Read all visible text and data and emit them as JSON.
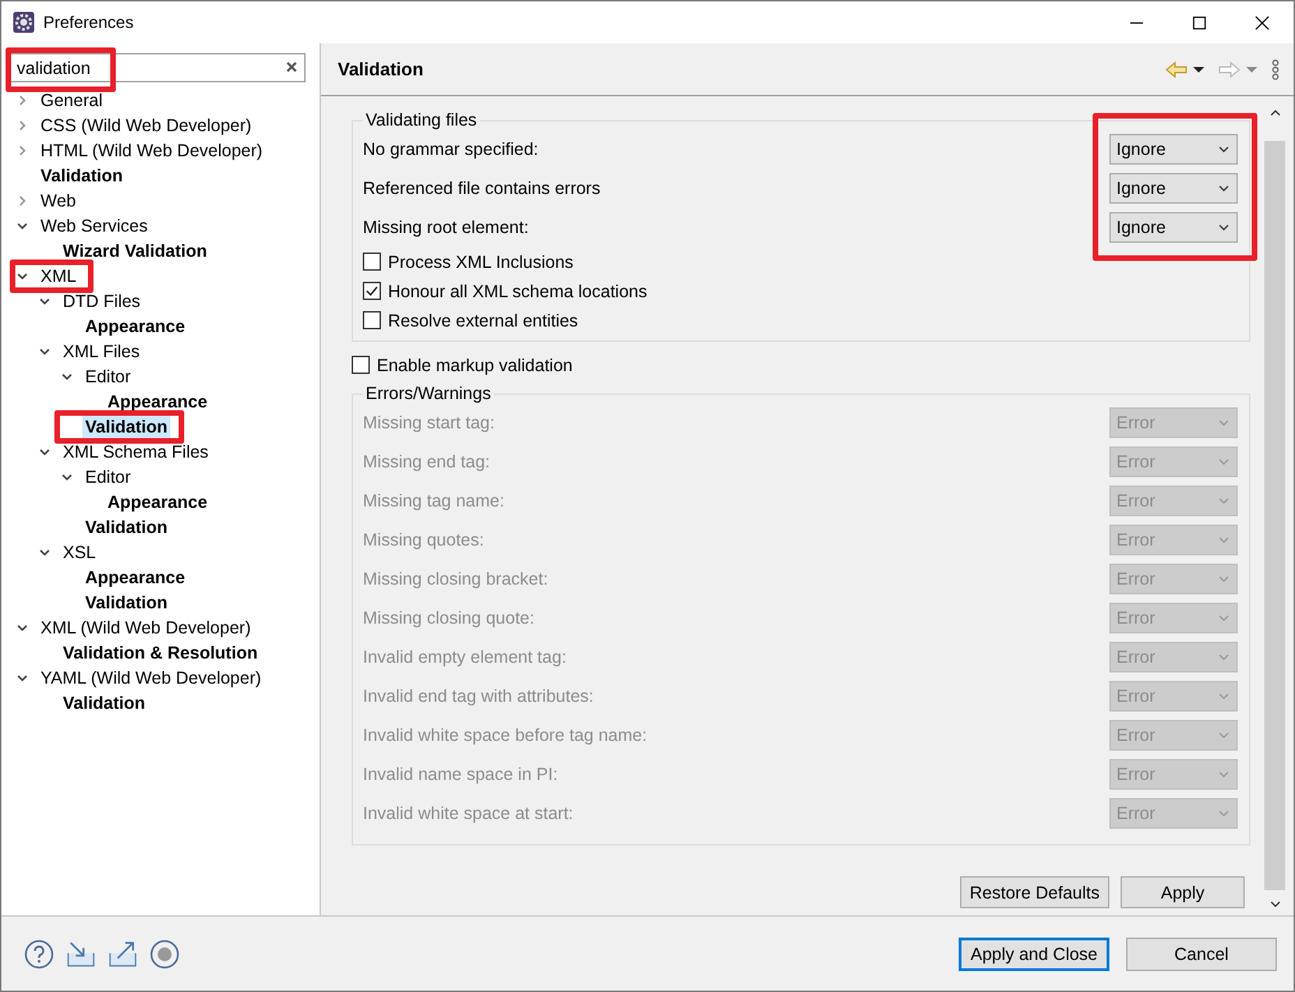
{
  "window": {
    "title": "Preferences"
  },
  "search": {
    "value": "validation",
    "highlighted": true
  },
  "tree": [
    {
      "label": "General",
      "matched": false,
      "expanded": false,
      "selected": false,
      "highlighted": false
    },
    {
      "label": "CSS (Wild Web Developer)",
      "matched": false,
      "expanded": false,
      "selected": false,
      "highlighted": false
    },
    {
      "label": "HTML (Wild Web Developer)",
      "matched": false,
      "expanded": false,
      "selected": false,
      "highlighted": false
    },
    {
      "label": "Validation",
      "matched": true,
      "selected": false,
      "highlighted": false
    },
    {
      "label": "Web",
      "matched": false,
      "expanded": false,
      "selected": false,
      "highlighted": false
    },
    {
      "label": "Web Services",
      "matched": false,
      "expanded": true,
      "selected": false,
      "highlighted": false,
      "children": [
        {
          "label": "Wizard Validation",
          "matched": true,
          "selected": false,
          "highlighted": false
        }
      ]
    },
    {
      "label": "XML",
      "matched": false,
      "expanded": true,
      "selected": false,
      "highlighted": true,
      "children": [
        {
          "label": "DTD Files",
          "matched": false,
          "expanded": true,
          "selected": false,
          "highlighted": false,
          "children": [
            {
              "label": "Appearance",
              "matched": true,
              "selected": false,
              "highlighted": false
            }
          ]
        },
        {
          "label": "XML Files",
          "matched": false,
          "expanded": true,
          "selected": false,
          "highlighted": false,
          "children": [
            {
              "label": "Editor",
              "matched": false,
              "expanded": true,
              "selected": false,
              "highlighted": false,
              "children": [
                {
                  "label": "Appearance",
                  "matched": true,
                  "selected": false,
                  "highlighted": false
                }
              ]
            },
            {
              "label": "Validation",
              "matched": true,
              "selected": true,
              "highlighted": true
            }
          ]
        },
        {
          "label": "XML Schema Files",
          "matched": false,
          "expanded": true,
          "selected": false,
          "highlighted": false,
          "children": [
            {
              "label": "Editor",
              "matched": false,
              "expanded": true,
              "selected": false,
              "highlighted": false,
              "children": [
                {
                  "label": "Appearance",
                  "matched": true,
                  "selected": false,
                  "highlighted": false
                }
              ]
            },
            {
              "label": "Validation",
              "matched": true,
              "selected": false,
              "highlighted": false
            }
          ]
        },
        {
          "label": "XSL",
          "matched": false,
          "expanded": true,
          "selected": false,
          "highlighted": false,
          "children": [
            {
              "label": "Appearance",
              "matched": true,
              "selected": false,
              "highlighted": false
            },
            {
              "label": "Validation",
              "matched": true,
              "selected": false,
              "highlighted": false
            }
          ]
        }
      ]
    },
    {
      "label": "XML (Wild Web Developer)",
      "matched": false,
      "expanded": true,
      "selected": false,
      "highlighted": false,
      "children": [
        {
          "label": "Validation & Resolution",
          "matched": true,
          "selected": false,
          "highlighted": false
        }
      ]
    },
    {
      "label": "YAML (Wild Web Developer)",
      "matched": false,
      "expanded": true,
      "selected": false,
      "highlighted": false,
      "children": [
        {
          "label": "Validation",
          "matched": true,
          "selected": false,
          "highlighted": false
        }
      ]
    }
  ],
  "page": {
    "title": "Validation"
  },
  "validating_files": {
    "title": "Validating files",
    "selects_highlighted": true,
    "selects": [
      {
        "label": "No grammar specified:",
        "value": "Ignore"
      },
      {
        "label": "Referenced file contains errors",
        "value": "Ignore"
      },
      {
        "label": "Missing root element:",
        "value": "Ignore"
      }
    ],
    "checkboxes": [
      {
        "label": "Process XML Inclusions",
        "checked": false
      },
      {
        "label": "Honour all XML schema locations",
        "checked": true
      },
      {
        "label": "Resolve external entities",
        "checked": false
      }
    ]
  },
  "markup_validation": {
    "label": "Enable markup validation",
    "checked": false
  },
  "errors_warnings": {
    "title": "Errors/Warnings",
    "disabled": true,
    "rows": [
      {
        "label": "Missing start tag:",
        "value": "Error"
      },
      {
        "label": "Missing end tag:",
        "value": "Error"
      },
      {
        "label": "Missing tag name:",
        "value": "Error"
      },
      {
        "label": "Missing quotes:",
        "value": "Error"
      },
      {
        "label": "Missing closing bracket:",
        "value": "Error"
      },
      {
        "label": "Missing closing quote:",
        "value": "Error"
      },
      {
        "label": "Invalid empty element tag:",
        "value": "Error"
      },
      {
        "label": "Invalid end tag with attributes:",
        "value": "Error"
      },
      {
        "label": "Invalid white space before tag name:",
        "value": "Error"
      },
      {
        "label": "Invalid name space in PI:",
        "value": "Error"
      },
      {
        "label": "Invalid white space at start:",
        "value": "Error"
      }
    ]
  },
  "page_buttons": [
    "Restore Defaults",
    "Apply"
  ],
  "dialog_buttons": [
    {
      "label": "Apply and Close",
      "default": true
    },
    {
      "label": "Cancel",
      "default": false
    }
  ]
}
